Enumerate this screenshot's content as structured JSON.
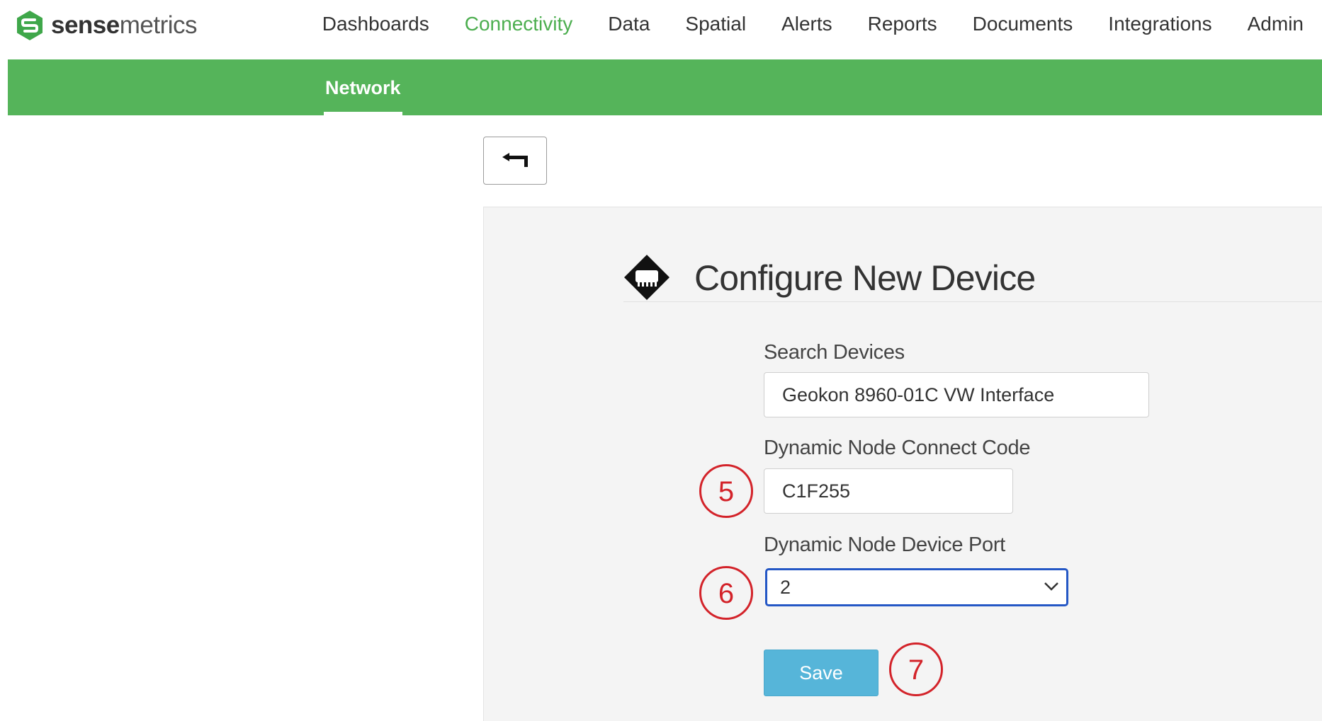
{
  "brand": {
    "name_bold": "sense",
    "name_light": "metrics",
    "color": "#4cae4f"
  },
  "nav": {
    "items": [
      {
        "label": "Dashboards",
        "active": false
      },
      {
        "label": "Connectivity",
        "active": true
      },
      {
        "label": "Data",
        "active": false
      },
      {
        "label": "Spatial",
        "active": false
      },
      {
        "label": "Alerts",
        "active": false
      },
      {
        "label": "Reports",
        "active": false
      },
      {
        "label": "Documents",
        "active": false
      },
      {
        "label": "Integrations",
        "active": false
      },
      {
        "label": "Admin",
        "active": false
      }
    ],
    "active_color": "#4cae4f"
  },
  "subnav": {
    "active_tab": "Network",
    "bar_color": "#55b45a"
  },
  "back_button": {
    "icon": "return-arrow-icon"
  },
  "form": {
    "title": "Configure New Device",
    "title_icon": "device-diamond-icon",
    "search": {
      "label": "Search Devices",
      "value": "Geokon 8960-01C VW Interface"
    },
    "connect_code": {
      "label": "Dynamic Node Connect Code",
      "value": "C1F255"
    },
    "device_port": {
      "label": "Dynamic Node Device Port",
      "value": "2"
    },
    "save_label": "Save",
    "save_color": "#56b5d9"
  },
  "annotations": {
    "step_5": "5",
    "step_6": "6",
    "step_7": "7",
    "color": "#d3232a"
  }
}
